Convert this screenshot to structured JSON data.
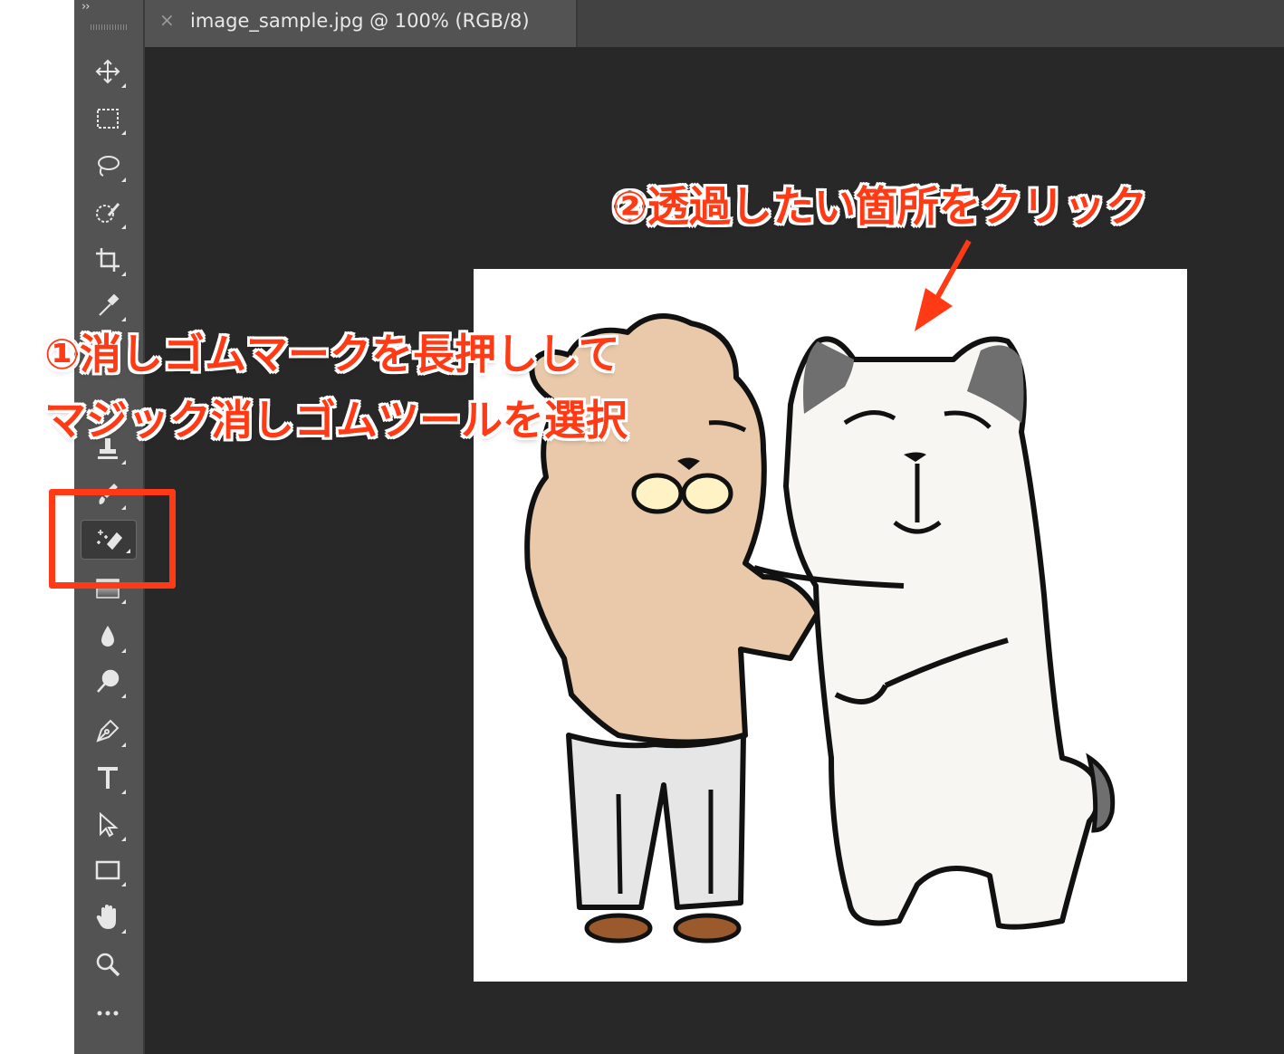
{
  "tab": {
    "close_icon": "close-icon",
    "title": "image_sample.jpg @ 100% (RGB/8)"
  },
  "toolbar": {
    "collapse": "››",
    "tools": [
      {
        "name": "move-tool",
        "icon": "move-icon"
      },
      {
        "name": "marquee-tool",
        "icon": "marquee-icon"
      },
      {
        "name": "lasso-tool",
        "icon": "lasso-icon"
      },
      {
        "name": "quick-selection-tool",
        "icon": "quick-selection-icon"
      },
      {
        "name": "crop-tool",
        "icon": "crop-icon"
      },
      {
        "name": "eyedropper-tool",
        "icon": "eyedropper-icon"
      },
      {
        "name": "clone-stamp-tool",
        "icon": "stamp-icon"
      },
      {
        "name": "history-brush-tool",
        "icon": "history-brush-icon"
      },
      {
        "name": "magic-eraser-tool",
        "icon": "magic-eraser-icon",
        "active": true
      },
      {
        "name": "gradient-tool",
        "icon": "gradient-icon"
      },
      {
        "name": "blur-tool",
        "icon": "drop-icon"
      },
      {
        "name": "dodge-tool",
        "icon": "dodge-icon"
      },
      {
        "name": "pen-tool",
        "icon": "pen-icon"
      },
      {
        "name": "type-tool",
        "icon": "type-icon"
      },
      {
        "name": "path-selection-tool",
        "icon": "arrow-icon"
      },
      {
        "name": "rectangle-tool",
        "icon": "rectangle-icon"
      },
      {
        "name": "hand-tool",
        "icon": "hand-icon"
      },
      {
        "name": "zoom-tool",
        "icon": "zoom-icon"
      },
      {
        "name": "more-tools",
        "icon": "more-icon"
      }
    ]
  },
  "annotations": {
    "step1_line1": "①消しゴムマークを長押しして",
    "step1_line2": "マジック消しゴムツールを選択",
    "step2": "②透過したい箇所をクリック"
  },
  "colors": {
    "accent": "#ff3a14",
    "panel": "#535353",
    "workspace": "#282828",
    "tabbar": "#424242"
  }
}
